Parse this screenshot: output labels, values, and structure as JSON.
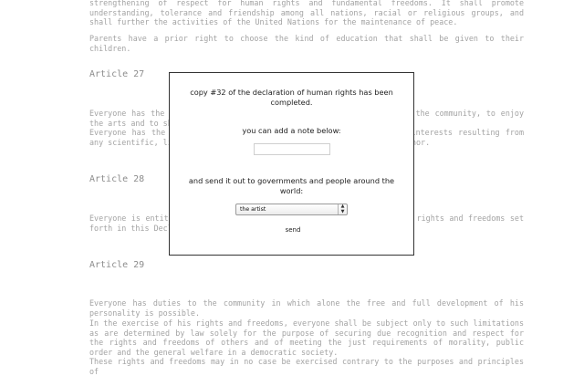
{
  "background": {
    "intro_lines": "strengthening of respect for human rights and fundamental freedoms. It shall promote understanding, tolerance and friendship among all nations, racial or religious groups, and shall further the activities of the United Nations for the maintenance of peace.",
    "intro_parents": "Parents have a prior right to choose the kind of education that shall be given to their children.",
    "article27": {
      "heading": "Article 27",
      "p1": "Everyone has the right freely to participate in the cultural life of the community, to enjoy the arts and to share in scientific advancement and its benefits.",
      "p2": "Everyone has the right to the protection of the moral and material interests resulting from any scientific, literary or artistic production of which he is the author."
    },
    "article28": {
      "heading": "Article 28",
      "p1": "Everyone is entitled to a social and international order in which the rights and freedoms set forth in this Declaration can be fully realized."
    },
    "article29": {
      "heading": "Article 29",
      "p1": "Everyone has duties to the community in which alone the free and full development of his personality is possible.",
      "p2": "In the exercise of his rights and freedoms, everyone shall be subject only to such limitations as are determined by law solely for the purpose of securing due recognition and respect for the rights and freedoms of others and of meeting the just requirements of morality, public order and the general welfare in a democratic society.",
      "p3": "These rights and freedoms may in no case be exercised contrary to the purposes and principles of"
    }
  },
  "modal": {
    "completed_message": "copy #32 of the declaration of human rights has been completed.",
    "note_prompt": "you can add a note below:",
    "note_value": "",
    "send_prompt": "and send it out to governments and people around the world:",
    "recipient_selected": "the artist",
    "send_label": "send"
  }
}
